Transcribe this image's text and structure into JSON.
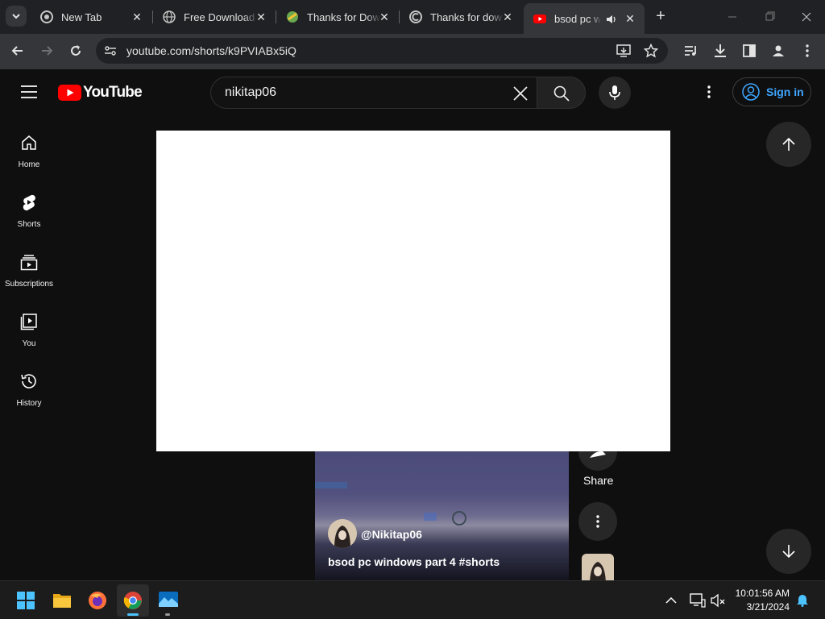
{
  "browser": {
    "tabs": [
      {
        "title": "New Tab",
        "active": false
      },
      {
        "title": "Free Download",
        "active": false
      },
      {
        "title": "Thanks for Dow",
        "active": false
      },
      {
        "title": "Thanks for dow",
        "active": false
      },
      {
        "title": "bsod pc win",
        "active": true
      }
    ],
    "url": "youtube.com/shorts/k9PVIABx5iQ"
  },
  "youtube": {
    "logo_text": "YouTube",
    "search_value": "nikitap06",
    "sign_in_label": "Sign in",
    "nav": [
      {
        "label": "Home",
        "icon": "home-icon"
      },
      {
        "label": "Shorts",
        "icon": "shorts-icon"
      },
      {
        "label": "Subscriptions",
        "icon": "subscriptions-icon"
      },
      {
        "label": "You",
        "icon": "you-icon"
      },
      {
        "label": "History",
        "icon": "history-icon"
      }
    ]
  },
  "short": {
    "channel": "@Nikitap06",
    "caption": "bsod pc windows part 4 #shorts",
    "share_label": "Share"
  },
  "taskbar": {
    "time": "10:01:56 AM",
    "date": "3/21/2024"
  },
  "colors": {
    "accent": "#3ea6ff",
    "brand_red": "#ff0000",
    "bg": "#0f0f0f"
  }
}
